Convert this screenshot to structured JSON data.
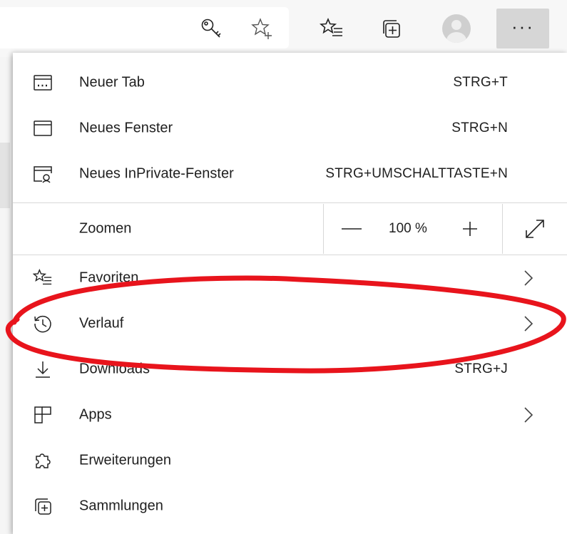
{
  "toolbar": {
    "icons": [
      "key-icon",
      "add-favorite-star-icon",
      "favorites-icon",
      "collections-icon",
      "profile-avatar-icon",
      "more-icon"
    ],
    "more_label": "···"
  },
  "menu": {
    "items": [
      {
        "label": "Neuer Tab",
        "shortcut": "STRG+T",
        "icon": "new-tab-icon"
      },
      {
        "label": "Neues Fenster",
        "shortcut": "STRG+N",
        "icon": "new-window-icon"
      },
      {
        "label": "Neues InPrivate-Fenster",
        "shortcut": "STRG+UMSCHALTTASTE+N",
        "icon": "inprivate-window-icon"
      }
    ],
    "zoom": {
      "label": "Zoomen",
      "value": "100 %",
      "minus": "—",
      "plus": "+"
    },
    "items2": [
      {
        "label": "Favoriten",
        "icon": "favorites-icon"
      },
      {
        "label": "Verlauf",
        "icon": "history-icon"
      },
      {
        "label": "Downloads",
        "shortcut": "STRG+J",
        "icon": "download-icon"
      },
      {
        "label": "Apps",
        "icon": "apps-icon"
      },
      {
        "label": "Erweiterungen",
        "icon": "extensions-icon"
      },
      {
        "label": "Sammlungen",
        "icon": "collections-icon"
      }
    ]
  },
  "annotation": {
    "color": "#e8141c"
  },
  "colors": {
    "menu_bg": "#ffffff",
    "toolbar_bg": "#f7f7f7",
    "more_button_bg": "#d6d6d6",
    "divider": "#d8d8d8"
  }
}
